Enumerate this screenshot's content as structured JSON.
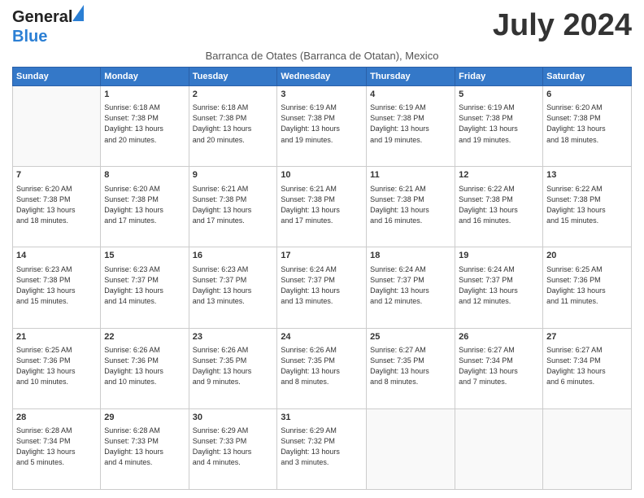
{
  "logo": {
    "line1": "General",
    "line2": "Blue"
  },
  "title": "July 2024",
  "location": "Barranca de Otates (Barranca de Otatan), Mexico",
  "days_of_week": [
    "Sunday",
    "Monday",
    "Tuesday",
    "Wednesday",
    "Thursday",
    "Friday",
    "Saturday"
  ],
  "weeks": [
    [
      {
        "day": "",
        "info": ""
      },
      {
        "day": "1",
        "info": "Sunrise: 6:18 AM\nSunset: 7:38 PM\nDaylight: 13 hours\nand 20 minutes."
      },
      {
        "day": "2",
        "info": "Sunrise: 6:18 AM\nSunset: 7:38 PM\nDaylight: 13 hours\nand 20 minutes."
      },
      {
        "day": "3",
        "info": "Sunrise: 6:19 AM\nSunset: 7:38 PM\nDaylight: 13 hours\nand 19 minutes."
      },
      {
        "day": "4",
        "info": "Sunrise: 6:19 AM\nSunset: 7:38 PM\nDaylight: 13 hours\nand 19 minutes."
      },
      {
        "day": "5",
        "info": "Sunrise: 6:19 AM\nSunset: 7:38 PM\nDaylight: 13 hours\nand 19 minutes."
      },
      {
        "day": "6",
        "info": "Sunrise: 6:20 AM\nSunset: 7:38 PM\nDaylight: 13 hours\nand 18 minutes."
      }
    ],
    [
      {
        "day": "7",
        "info": ""
      },
      {
        "day": "8",
        "info": "Sunrise: 6:20 AM\nSunset: 7:38 PM\nDaylight: 13 hours\nand 17 minutes."
      },
      {
        "day": "9",
        "info": "Sunrise: 6:21 AM\nSunset: 7:38 PM\nDaylight: 13 hours\nand 17 minutes."
      },
      {
        "day": "10",
        "info": "Sunrise: 6:21 AM\nSunset: 7:38 PM\nDaylight: 13 hours\nand 17 minutes."
      },
      {
        "day": "11",
        "info": "Sunrise: 6:21 AM\nSunset: 7:38 PM\nDaylight: 13 hours\nand 16 minutes."
      },
      {
        "day": "12",
        "info": "Sunrise: 6:22 AM\nSunset: 7:38 PM\nDaylight: 13 hours\nand 16 minutes."
      },
      {
        "day": "13",
        "info": "Sunrise: 6:22 AM\nSunset: 7:38 PM\nDaylight: 13 hours\nand 15 minutes."
      }
    ],
    [
      {
        "day": "14",
        "info": ""
      },
      {
        "day": "15",
        "info": "Sunrise: 6:23 AM\nSunset: 7:37 PM\nDaylight: 13 hours\nand 14 minutes."
      },
      {
        "day": "16",
        "info": "Sunrise: 6:23 AM\nSunset: 7:37 PM\nDaylight: 13 hours\nand 13 minutes."
      },
      {
        "day": "17",
        "info": "Sunrise: 6:24 AM\nSunset: 7:37 PM\nDaylight: 13 hours\nand 13 minutes."
      },
      {
        "day": "18",
        "info": "Sunrise: 6:24 AM\nSunset: 7:37 PM\nDaylight: 13 hours\nand 12 minutes."
      },
      {
        "day": "19",
        "info": "Sunrise: 6:24 AM\nSunset: 7:37 PM\nDaylight: 13 hours\nand 12 minutes."
      },
      {
        "day": "20",
        "info": "Sunrise: 6:25 AM\nSunset: 7:36 PM\nDaylight: 13 hours\nand 11 minutes."
      }
    ],
    [
      {
        "day": "21",
        "info": "Sunrise: 6:25 AM\nSunset: 7:36 PM\nDaylight: 13 hours\nand 10 minutes."
      },
      {
        "day": "22",
        "info": "Sunrise: 6:26 AM\nSunset: 7:36 PM\nDaylight: 13 hours\nand 10 minutes."
      },
      {
        "day": "23",
        "info": "Sunrise: 6:26 AM\nSunset: 7:35 PM\nDaylight: 13 hours\nand 9 minutes."
      },
      {
        "day": "24",
        "info": "Sunrise: 6:26 AM\nSunset: 7:35 PM\nDaylight: 13 hours\nand 8 minutes."
      },
      {
        "day": "25",
        "info": "Sunrise: 6:27 AM\nSunset: 7:35 PM\nDaylight: 13 hours\nand 8 minutes."
      },
      {
        "day": "26",
        "info": "Sunrise: 6:27 AM\nSunset: 7:34 PM\nDaylight: 13 hours\nand 7 minutes."
      },
      {
        "day": "27",
        "info": "Sunrise: 6:27 AM\nSunset: 7:34 PM\nDaylight: 13 hours\nand 6 minutes."
      }
    ],
    [
      {
        "day": "28",
        "info": "Sunrise: 6:28 AM\nSunset: 7:34 PM\nDaylight: 13 hours\nand 5 minutes."
      },
      {
        "day": "29",
        "info": "Sunrise: 6:28 AM\nSunset: 7:33 PM\nDaylight: 13 hours\nand 4 minutes."
      },
      {
        "day": "30",
        "info": "Sunrise: 6:29 AM\nSunset: 7:33 PM\nDaylight: 13 hours\nand 4 minutes."
      },
      {
        "day": "31",
        "info": "Sunrise: 6:29 AM\nSunset: 7:32 PM\nDaylight: 13 hours\nand 3 minutes."
      },
      {
        "day": "",
        "info": ""
      },
      {
        "day": "",
        "info": ""
      },
      {
        "day": "",
        "info": ""
      }
    ]
  ],
  "week1_sunday_info": "Sunrise: 6:20 AM\nSunset: 7:38 PM\nDaylight: 13 hours\nand 18 minutes.",
  "week2_sunday_info": "Sunrise: 6:20 AM\nSunset: 7:38 PM\nDaylight: 13 hours\nand 18 minutes.",
  "week3_sunday_info": "Sunrise: 6:23 AM\nSunset: 7:38 PM\nDaylight: 13 hours\nand 15 minutes."
}
